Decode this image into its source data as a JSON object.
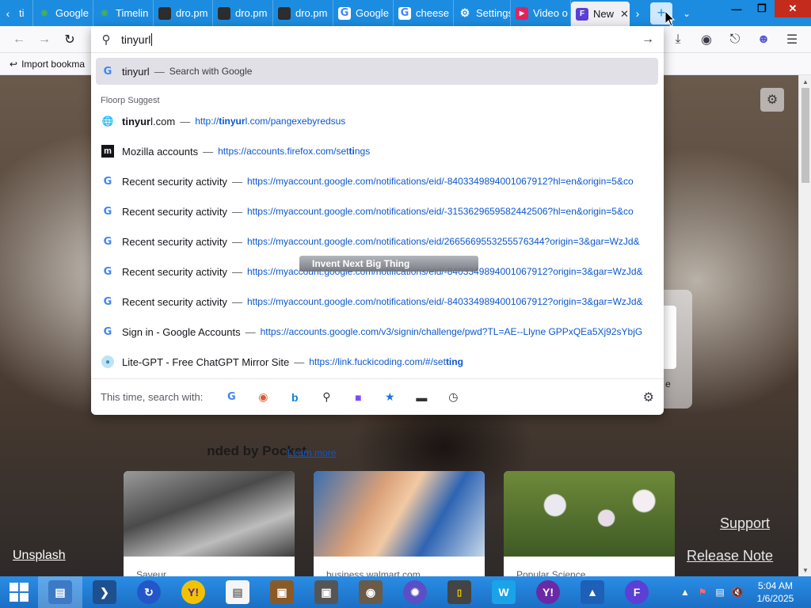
{
  "browser": {
    "tabs": [
      {
        "label": "ti",
        "icon": "tab-icon"
      },
      {
        "label": "Google",
        "icon": "maps-pin-icon"
      },
      {
        "label": "Timelin",
        "icon": "maps-pin-icon"
      },
      {
        "label": "dro.pm",
        "icon": "dropm-icon"
      },
      {
        "label": "dro.pm",
        "icon": "dropm-icon"
      },
      {
        "label": "dro.pm",
        "icon": "dropm-icon"
      },
      {
        "label": "Google",
        "icon": "google-icon"
      },
      {
        "label": "cheese",
        "icon": "google-icon"
      },
      {
        "label": "Settings",
        "icon": "gear-icon"
      },
      {
        "label": "Video o",
        "icon": "youtube-icon"
      },
      {
        "label": "New",
        "icon": "floorp-icon",
        "active": true
      }
    ],
    "bookmark_label": "Import bookma",
    "new_tab_glyph": "+"
  },
  "urlbar": {
    "typed": "tinyurl",
    "selected_row": {
      "title": "tinyurl",
      "action": "Search with Google"
    },
    "group_label": "Floorp Suggest",
    "suggestions": [
      {
        "title_bold": "tinyur",
        "title_rest": "l.com",
        "url_pre": "http://",
        "url_bold": "tinyur",
        "url_post": "l.com/pangexebyredsus",
        "icon": "globe-icon"
      },
      {
        "title": "Mozilla accounts",
        "url_pre": "https://accounts.firefox.com/set",
        "url_bold": "ti",
        "url_post": "ngs",
        "icon": "mozilla-icon"
      },
      {
        "title": "Recent security activity",
        "url": "https://myaccount.google.com/notifications/eid/-8403349894001067912?hl=en&origin=5&co",
        "icon": "google-icon"
      },
      {
        "title": "Recent security activity",
        "url": "https://myaccount.google.com/notifications/eid/-3153629659582442506?hl=en&origin=5&co",
        "icon": "google-icon"
      },
      {
        "title": "Recent security activity",
        "url": "https://myaccount.google.com/notifications/eid/2665669553255576344?origin=3&gar=WzJd&",
        "icon": "google-icon"
      },
      {
        "title": "Recent security activity",
        "url": "https://myaccount.google.com/notifications/eid/-8403349894001067912?origin=3&gar=WzJd&",
        "icon": "google-icon"
      },
      {
        "title": "Recent security activity",
        "url": "https://myaccount.google.com/notifications/eid/-8403349894001067912?origin=3&gar=WzJd&",
        "icon": "google-icon"
      },
      {
        "title": "Sign in - Google Accounts",
        "url": "https://accounts.google.com/v3/signin/challenge/pwd?TL=AE--Llyne GPPxQEa5Xj92sYbjG",
        "icon": "google-icon"
      },
      {
        "title": "Lite-GPT - Free ChatGPT Mirror Site",
        "url_pre": "https://link.fuckicoding.com/#/set",
        "url_bold": "ting",
        "url_post": "",
        "icon": "chatgpt-icon"
      }
    ],
    "search_with_label": "This time, search with:",
    "engines": [
      "google-icon",
      "duckduckgo-icon",
      "bing-icon",
      "search-engine-icon",
      "image-search-icon",
      "bookmarks-star-icon",
      "tabs-icon",
      "history-clock-icon"
    ],
    "overlay_banner": "Invent Next Big Thing"
  },
  "newtab": {
    "pocket_heading": "nded by Pocket",
    "learn_more": "Learn more",
    "shortcut_label": "e",
    "cards": [
      {
        "source": "Saveur"
      },
      {
        "source": "business.walmart.com"
      },
      {
        "source": "Popular Science"
      }
    ],
    "unsplash": "Unsplash",
    "support": "Support",
    "release_note": "Release Note"
  },
  "taskbar": {
    "apps": [
      "file-explorer-icon",
      "powershell-icon",
      "sync-icon",
      "yahoo-messenger-icon",
      "notepad-icon",
      "treasure-chest-icon",
      "screenshot-tool-icon",
      "gimp-icon",
      "spiky-ball-icon",
      "monitor-icon",
      "wiki-icon",
      "yahoo-messenger-icon",
      "triangle-app-icon",
      "floorp-icon"
    ],
    "time": "5:04 AM",
    "date": "1/6/2025"
  },
  "colors": {
    "tabstrip": "#1c8ce0",
    "link": "#0b57d0",
    "taskbar": "#1b6fc4"
  }
}
